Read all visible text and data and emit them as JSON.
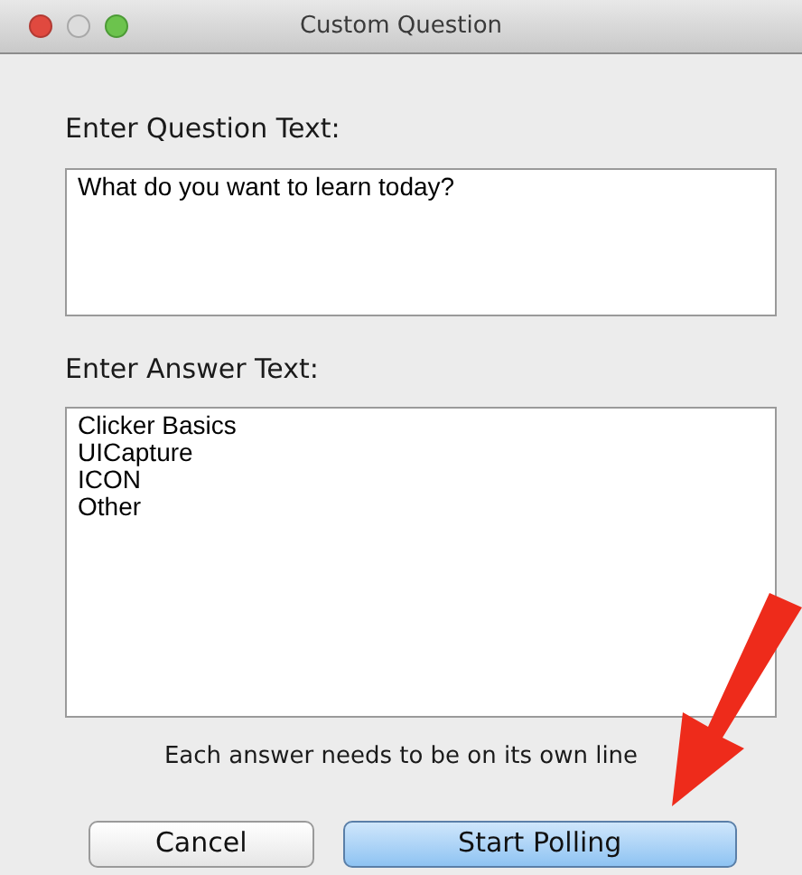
{
  "window": {
    "title": "Custom Question"
  },
  "question": {
    "label": "Enter Question Text:",
    "value": "What do you want to learn today?"
  },
  "answers": {
    "label": "Enter Answer Text:",
    "lines": [
      "Clicker Basics",
      "UICapture",
      "ICON",
      "Other"
    ]
  },
  "hint": "Each answer needs to be on its own line",
  "buttons": [
    {
      "label": "Cancel",
      "default": false
    },
    {
      "label": "Start Polling",
      "default": true
    }
  ]
}
